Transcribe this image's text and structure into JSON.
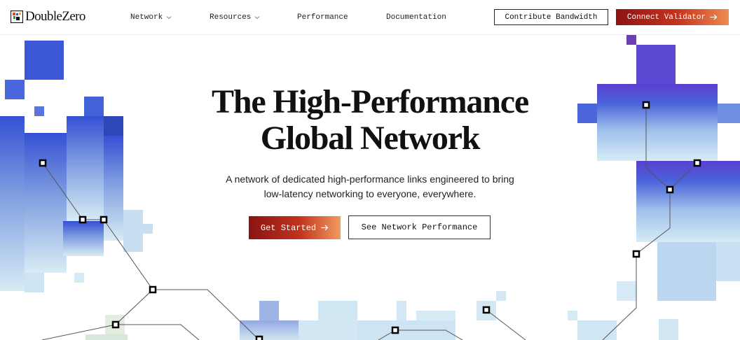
{
  "brand": {
    "name": "DoubleZero",
    "logo_icon": "doublezero-logo-icon"
  },
  "nav": {
    "network": "Network",
    "resources": "Resources",
    "performance": "Performance",
    "documentation": "Documentation"
  },
  "header_buttons": {
    "contribute": "Contribute Bandwidth",
    "connect": "Connect Validator"
  },
  "hero": {
    "title_line1": "The High-Performance",
    "title_line2": "Global Network",
    "subtitle_line1": "A network of dedicated high-performance links engineered to bring",
    "subtitle_line2": "low-latency networking to everyone, everywhere.",
    "primary_cta": "Get Started",
    "secondary_cta": "See Network Performance"
  },
  "colors": {
    "accent_dark": "#8a1313",
    "accent_mid": "#c0331c",
    "accent_light": "#f19a60",
    "pixel_blue": "#3a57d6",
    "pixel_light": "#cfe6f3"
  }
}
